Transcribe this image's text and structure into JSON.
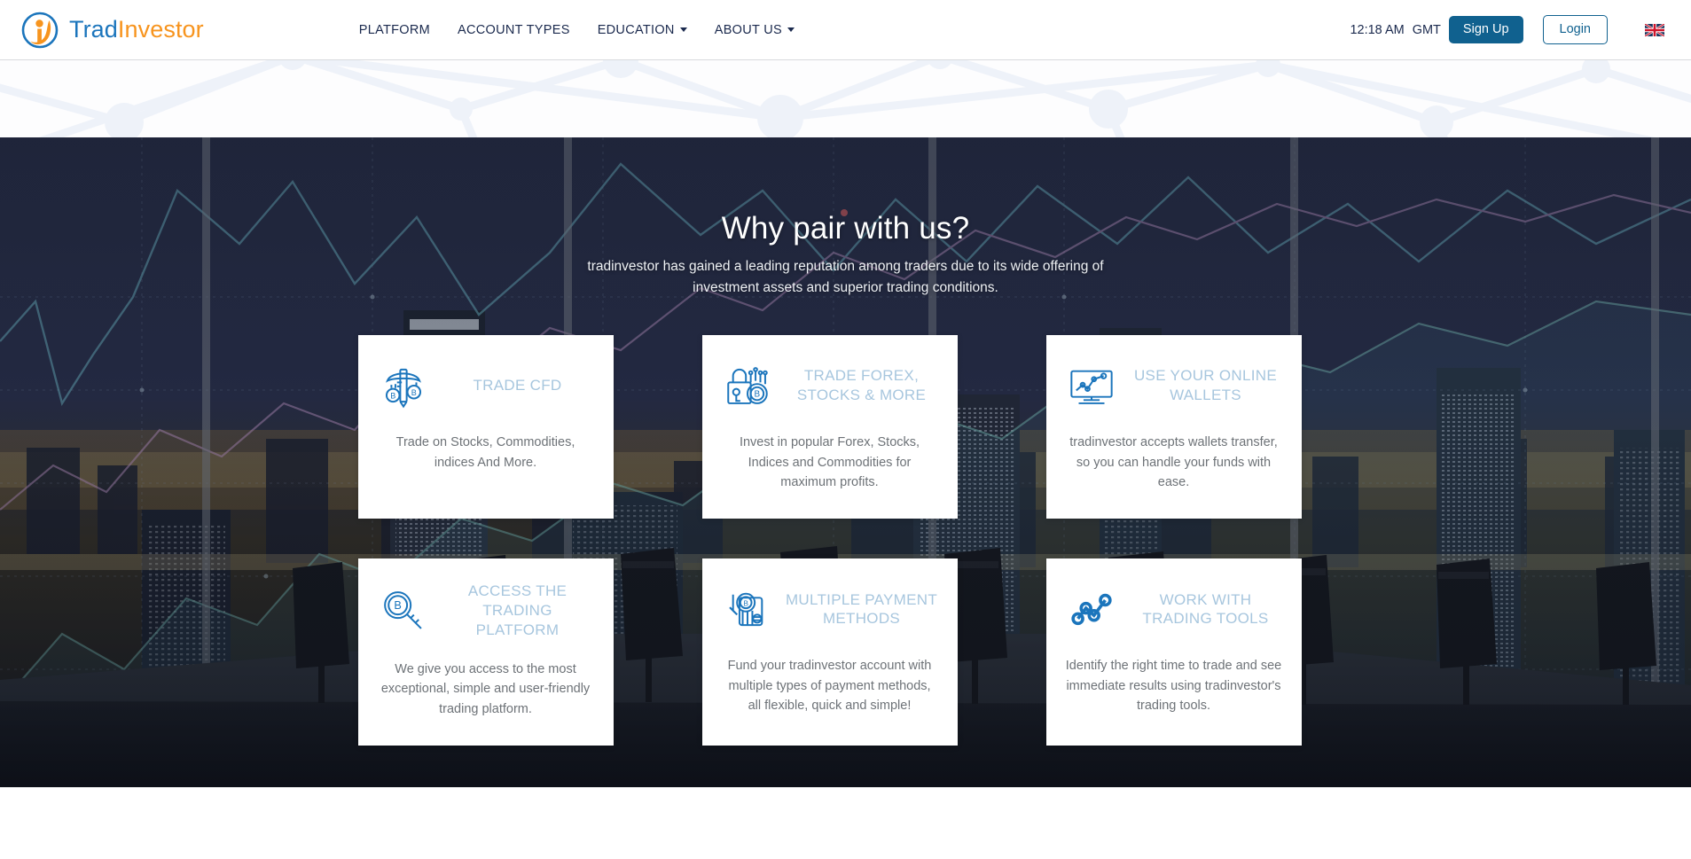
{
  "header": {
    "logo": {
      "part1": "Trad",
      "part2": "Investor",
      "icon": "tradinvestor-logo-icon"
    },
    "nav": [
      {
        "label": "PLATFORM",
        "has_caret": false
      },
      {
        "label": "ACCOUNT TYPES",
        "has_caret": false
      },
      {
        "label": "EDUCATION",
        "has_caret": true
      },
      {
        "label": "ABOUT US",
        "has_caret": true
      }
    ],
    "clock": {
      "time": "12:18 AM",
      "zone": "GMT"
    },
    "signup_label": "Sign Up",
    "login_label": "Login",
    "language_flag": "uk-flag-icon"
  },
  "hero": {
    "title": "Why pair with us?",
    "subtitle": "tradinvestor has gained a leading reputation among traders due to its wide offering of investment assets and superior trading conditions."
  },
  "cards": [
    {
      "icon": "pickaxe-bitcoin-icon",
      "title": "TRADE CFD",
      "body": "Trade on Stocks, Commodities, indices And More."
    },
    {
      "icon": "lock-key-bitcoin-icon",
      "title": "TRADE FOREX, STOCKS & MORE",
      "body": "Invest in popular Forex, Stocks, Indices and Commodities for maximum profits."
    },
    {
      "icon": "monitor-chart-icon",
      "title": "USE YOUR ONLINE WALLETS",
      "body": "tradinvestor accepts wallets transfer, so you can handle your funds with ease."
    },
    {
      "icon": "magnifier-bitcoin-icon",
      "title": "ACCESS THE TRADING PLATFORM",
      "body": "We give you access to the most exceptional, simple and user-friendly trading platform."
    },
    {
      "icon": "payment-card-coin-icon",
      "title": "MULTIPLE PAYMENT METHODS",
      "body": "Fund your tradinvestor account with multiple types of payment methods, all flexible, quick and simple!"
    },
    {
      "icon": "node-graph-icon",
      "title": "WORK WITH TRADING TOOLS",
      "body": "Identify the right time to trade and see immediate results using tradinvestor's trading tools."
    }
  ],
  "colors": {
    "brand_blue": "#1b75bc",
    "brand_orange": "#f7941e",
    "nav_text": "#1b2a4e",
    "button_blue": "#10618f",
    "card_title": "#a7c6de",
    "card_body": "#6d7277",
    "icon_blue": "#1b75bc"
  }
}
